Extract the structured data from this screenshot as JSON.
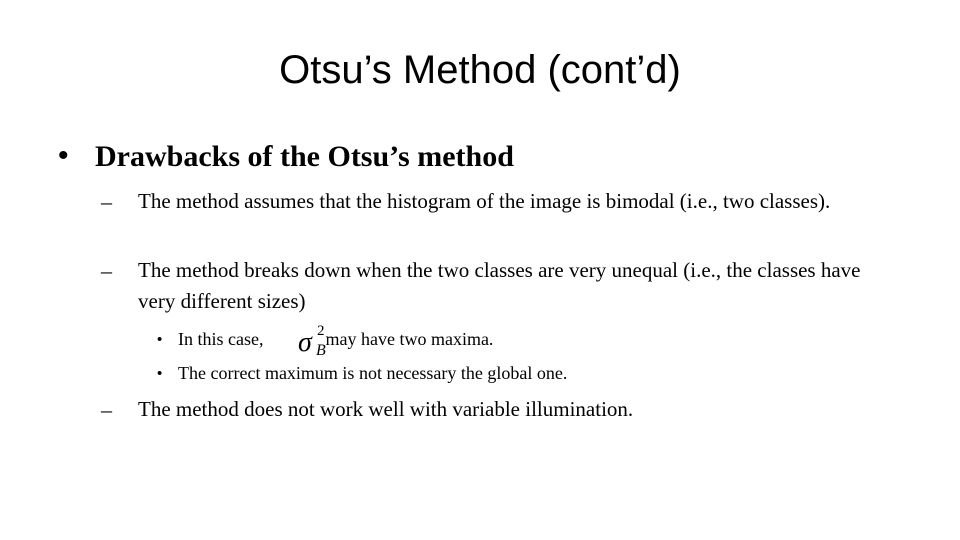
{
  "slide": {
    "title": "Otsu’s Method (cont’d)",
    "heading_bullet": "•",
    "heading": "Drawbacks of the Otsu’s method",
    "points": [
      {
        "marker": "–",
        "text": "The method assumes that the histogram of the image is bimodal (i.e., two classes)."
      },
      {
        "marker": "–",
        "text": "The method breaks down when the two classes are very unequal (i.e., the classes have very different sizes)"
      },
      {
        "marker": "–",
        "text": "The method does not work well with variable illumination."
      }
    ],
    "sub_points": [
      {
        "marker": "•",
        "text_before": "In this case,",
        "text_after": "may have two maxima."
      },
      {
        "marker": "•",
        "text": "The correct maximum is not necessary the global one."
      }
    ],
    "formula": {
      "symbol": "σ",
      "superscript": "2",
      "subscript": "B"
    }
  }
}
